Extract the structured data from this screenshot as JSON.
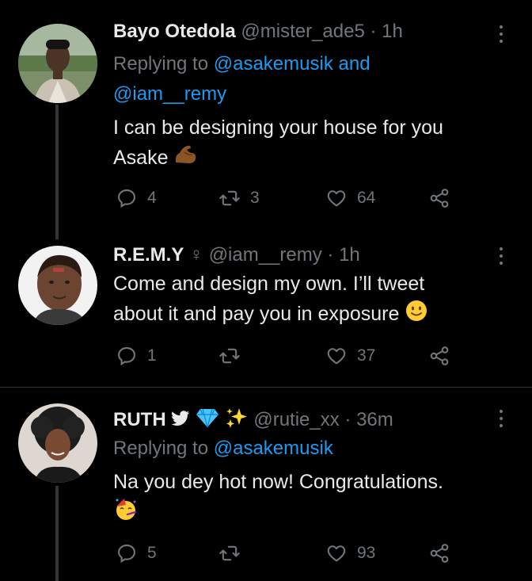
{
  "tweets": [
    {
      "name": "Bayo Otedola",
      "meta": "@mister_ade5 · 1h",
      "reply_prefix": "Replying to",
      "reply_mentions_line1": "@asakemusik and",
      "reply_mentions_line2": "@iam__remy",
      "text_line1": "I can be designing your house for you",
      "text_line2": "Asake",
      "replies": "4",
      "retweets": "3",
      "likes": "64"
    },
    {
      "name": "R.E.M.Y",
      "name_symbol": "♀",
      "meta": "@iam__remy · 1h",
      "text_line1": "Come and design my own. I’ll tweet",
      "text_line2": "about it and pay you in exposure",
      "replies": "1",
      "retweets": "",
      "likes": "37"
    },
    {
      "name": "RUTH",
      "meta": "@rutie_xx · 36m",
      "reply_prefix": "Replying to",
      "reply_mentions_line1": "@asakemusik",
      "text_line1": "Na you dey hot now! Congratulations.",
      "replies": "5",
      "retweets": "",
      "likes": "93"
    }
  ],
  "colors": {
    "background": "#000000",
    "text": "#e7e9ea",
    "muted": "#71767b",
    "link": "#1d9bf0"
  }
}
